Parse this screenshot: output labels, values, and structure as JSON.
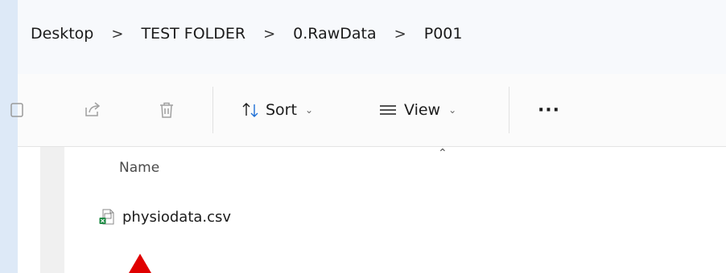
{
  "breadcrumb": {
    "items": [
      "Desktop",
      "TEST FOLDER",
      "0.RawData",
      "P001"
    ],
    "separator": ">"
  },
  "command_bar": {
    "sort_label": "Sort",
    "view_label": "View",
    "more_label": "···",
    "icons": [
      "partial-icon",
      "share-icon",
      "delete-icon",
      "sort-icon",
      "view-icon",
      "more-icon"
    ]
  },
  "file_list": {
    "column_header": "Name",
    "files": [
      {
        "name": "physiodata.csv",
        "icon": "csv-file-icon"
      }
    ]
  },
  "colors": {
    "address_bg": "#f7f9fc",
    "left_edge": "#dde9f7",
    "annotation_arrow": "#e00000"
  }
}
